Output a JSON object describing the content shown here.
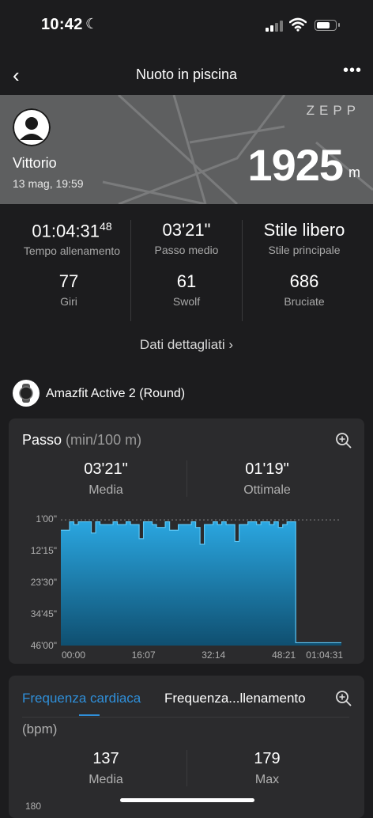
{
  "status_bar": {
    "time": "10:42"
  },
  "header": {
    "title": "Nuoto in piscina"
  },
  "banner": {
    "brand": "ZEPP",
    "user_name": "Vittorio",
    "date": "13 mag, 19:59",
    "distance": "1925",
    "distance_unit": "m"
  },
  "stats": [
    {
      "value": "01:04:31",
      "sup": "48",
      "label": "Tempo allenamento"
    },
    {
      "value": "03'21\"",
      "sup": "",
      "label": "Passo medio"
    },
    {
      "value": "Stile libero",
      "sup": "",
      "label": "Stile principale"
    },
    {
      "value": "77",
      "sup": "",
      "label": "Giri"
    },
    {
      "value": "61",
      "sup": "",
      "label": "Swolf"
    },
    {
      "value": "686",
      "sup": "",
      "label": "Bruciate"
    }
  ],
  "details_link": "Dati dettagliati",
  "device": {
    "name": "Amazfit Active 2 (Round)"
  },
  "pace_card": {
    "title": "Passo",
    "unit": "(min/100 m)",
    "avg_value": "03'21\"",
    "avg_label": "Media",
    "best_value": "01'19\"",
    "best_label": "Ottimale"
  },
  "chart_data": {
    "type": "area",
    "title": "Passo",
    "ylabel": "(min/100 m)",
    "y_ticks": [
      "1'00\"",
      "12'15\"",
      "23'30\"",
      "34'45\"",
      "46'00\""
    ],
    "x_ticks": [
      "00:00",
      "16:07",
      "32:14",
      "48:21",
      "01:04:31"
    ],
    "ylim_minutes": [
      1,
      46
    ],
    "y_inverted": true,
    "x_unit": "minutes",
    "series": [
      {
        "x": [
          0,
          2,
          3,
          4,
          6,
          7,
          8,
          9,
          12,
          13,
          15,
          16,
          18,
          19,
          21,
          22,
          24,
          25,
          27,
          28,
          30,
          31,
          32,
          33,
          35,
          36,
          37,
          38,
          40,
          41,
          42,
          43,
          45,
          46,
          48,
          49,
          50,
          51,
          52,
          53,
          54
        ],
        "y": [
          5,
          2,
          3,
          2,
          2,
          6,
          2,
          3,
          2,
          3,
          2,
          3,
          8,
          2,
          3,
          4,
          2,
          5,
          3,
          3,
          2,
          4,
          10,
          3,
          2,
          3,
          2,
          3,
          9,
          3,
          3,
          2,
          3,
          2,
          3,
          2,
          4,
          3,
          2,
          2,
          45
        ]
      }
    ],
    "color": "#2a9fd6"
  },
  "hr_card": {
    "tab1": "Frequenza cardiaca",
    "tab2": "Frequenza...llenamento",
    "unit": "(bpm)",
    "avg_value": "137",
    "avg_label": "Media",
    "max_value": "179",
    "max_label": "Max",
    "y_tick": "180"
  }
}
